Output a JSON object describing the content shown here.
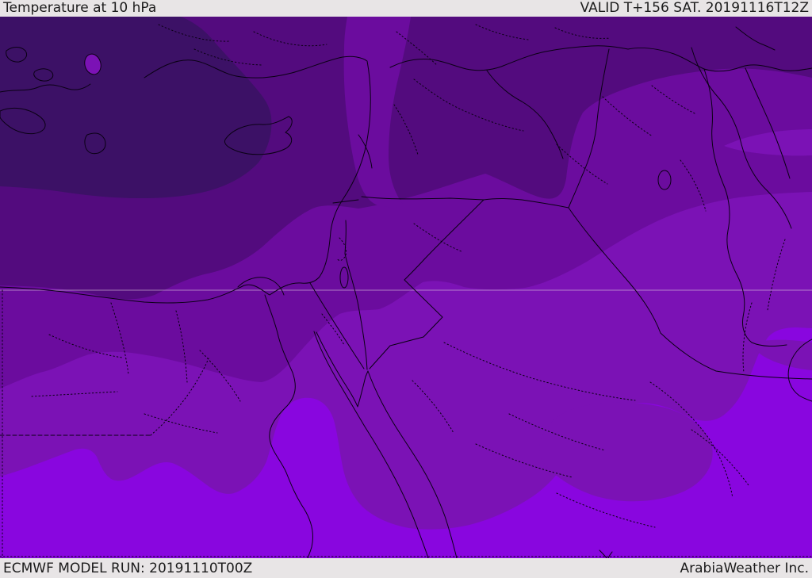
{
  "header": {
    "title": "Temperature at 10 hPa",
    "valid_label": "VALID T+156 SAT. 20191116T12Z"
  },
  "footer": {
    "model_run_label": "ECMWF MODEL RUN: 20191110T00Z",
    "credit_label": "ArabiaWeather Inc."
  },
  "map": {
    "parameter": "Temperature at 10 hPa",
    "bands": [
      {
        "name": "band-1-darkest-coldest",
        "color": "#3c1166"
      },
      {
        "name": "band-2-dark",
        "color": "#530b7e"
      },
      {
        "name": "band-3-medium",
        "color": "#6b0c9e"
      },
      {
        "name": "band-4-light",
        "color": "#7b12b5"
      },
      {
        "name": "band-5-brightest-warmest",
        "color": "#8906df"
      }
    ],
    "line_color": "#0a0014",
    "graticule_color": "#dcc6de",
    "bar_background": "#e8e5e6",
    "text_color": "#1c1c1c"
  }
}
